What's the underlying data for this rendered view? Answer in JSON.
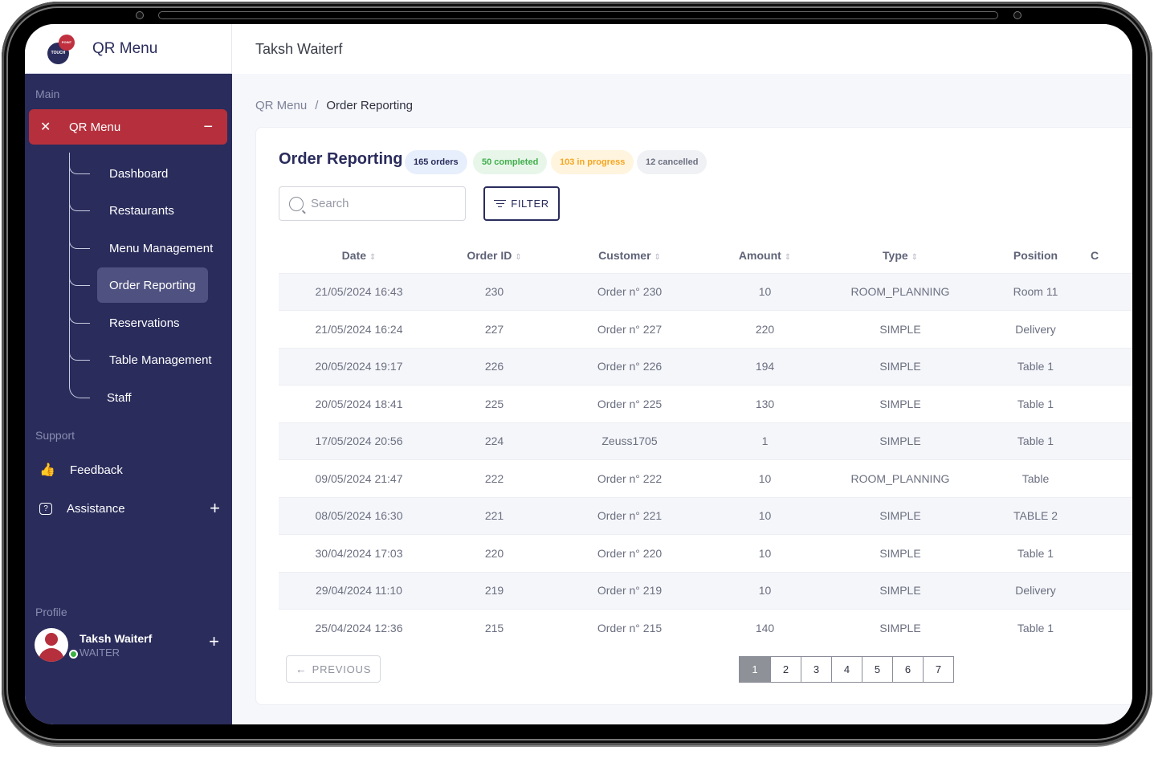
{
  "app": {
    "brand_title": "QR Menu",
    "logo_text_top": "POINT",
    "logo_text_bottom": "TOUCH",
    "header_title": "Taksh Waiterf"
  },
  "sidebar": {
    "main_label": "Main",
    "active_group": {
      "label": "QR Menu",
      "icon": "utensils-icon",
      "toggle": "−"
    },
    "sub_items": [
      {
        "label": "Dashboard",
        "active": false
      },
      {
        "label": "Restaurants",
        "active": false
      },
      {
        "label": "Menu Management",
        "active": false
      },
      {
        "label": "Order Reporting",
        "active": true
      },
      {
        "label": "Reservations",
        "active": false
      },
      {
        "label": "Table Management",
        "active": false
      },
      {
        "label": "Staff",
        "active": false
      }
    ],
    "support_label": "Support",
    "support_items": [
      {
        "label": "Feedback",
        "icon": "feedback-thumbs-icon"
      },
      {
        "label": "Assistance",
        "icon": "help-chat-icon",
        "toggle": "+"
      }
    ],
    "profile_label": "Profile",
    "profile": {
      "name": "Taksh Waiterf",
      "role": "WAITER",
      "status": "online",
      "toggle": "+"
    }
  },
  "breadcrumb": {
    "parent": "QR Menu",
    "separator": "/",
    "current": "Order Reporting"
  },
  "page": {
    "title": "Order Reporting",
    "badges": [
      {
        "label": "165 orders",
        "bg": "#e8effc",
        "fg": "#2a2c5c"
      },
      {
        "label": "50 completed",
        "bg": "#e8f6ea",
        "fg": "#3fae4a"
      },
      {
        "label": "103 in progress",
        "bg": "#fff4dd",
        "fg": "#f5a623"
      },
      {
        "label": "12 cancelled",
        "bg": "#f0f1f4",
        "fg": "#6b6f80"
      }
    ],
    "search": {
      "placeholder": "Search",
      "value": ""
    },
    "filter_label": "FILTER"
  },
  "table": {
    "columns": [
      {
        "label": "Date",
        "sortable": true
      },
      {
        "label": "Order ID",
        "sortable": true
      },
      {
        "label": "Customer",
        "sortable": true
      },
      {
        "label": "Amount",
        "sortable": true
      },
      {
        "label": "Type",
        "sortable": true
      },
      {
        "label": "Position",
        "sortable": false
      },
      {
        "label": "C",
        "sortable": false
      }
    ],
    "rows": [
      [
        "21/05/2024 16:43",
        "230",
        "Order n° 230",
        "10",
        "ROOM_PLANNING",
        "Room 11",
        ""
      ],
      [
        "21/05/2024 16:24",
        "227",
        "Order n° 227",
        "220",
        "SIMPLE",
        "Delivery",
        ""
      ],
      [
        "20/05/2024 19:17",
        "226",
        "Order n° 226",
        "194",
        "SIMPLE",
        "Table 1",
        ""
      ],
      [
        "20/05/2024 18:41",
        "225",
        "Order n° 225",
        "130",
        "SIMPLE",
        "Table 1",
        ""
      ],
      [
        "17/05/2024 20:56",
        "224",
        "Zeuss1705",
        "1",
        "SIMPLE",
        "Table 1",
        ""
      ],
      [
        "09/05/2024 21:47",
        "222",
        "Order n° 222",
        "10",
        "ROOM_PLANNING",
        "Table",
        ""
      ],
      [
        "08/05/2024 16:30",
        "221",
        "Order n° 221",
        "10",
        "SIMPLE",
        "TABLE 2",
        ""
      ],
      [
        "30/04/2024 17:03",
        "220",
        "Order n° 220",
        "10",
        "SIMPLE",
        "Table 1",
        ""
      ],
      [
        "29/04/2024 11:10",
        "219",
        "Order n° 219",
        "10",
        "SIMPLE",
        "Delivery",
        ""
      ],
      [
        "25/04/2024 12:36",
        "215",
        "Order n° 215",
        "140",
        "SIMPLE",
        "Table 1",
        ""
      ]
    ],
    "sort_glyph": "⇕"
  },
  "pagination": {
    "previous_label": "PREVIOUS",
    "pages": [
      "1",
      "2",
      "3",
      "4",
      "5",
      "6",
      "7"
    ],
    "current_page": "1"
  },
  "colors": {
    "sidebar_bg": "#2a2c5c",
    "accent_red": "#b5303c",
    "active_sub_bg": "#4f5280"
  }
}
